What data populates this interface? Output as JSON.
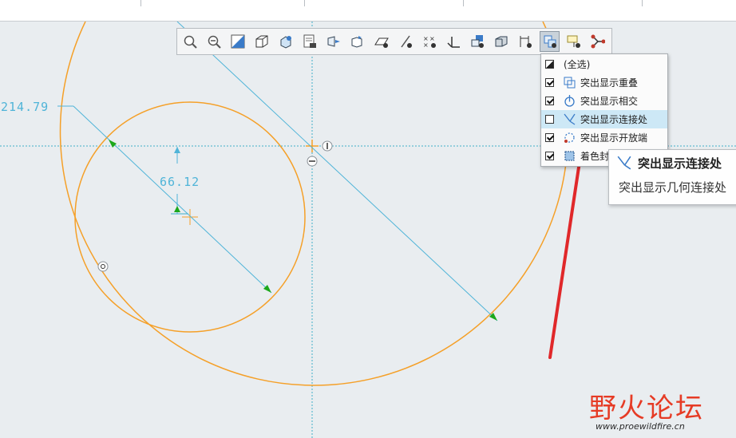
{
  "toolbar": {
    "buttons": [
      {
        "name": "zoom-in-button"
      },
      {
        "name": "zoom-out-button"
      },
      {
        "name": "refit-button"
      },
      {
        "name": "display-style-button"
      },
      {
        "name": "saved-orientations-button"
      },
      {
        "name": "view-manager-button"
      },
      {
        "name": "perspective-view-button"
      },
      {
        "name": "plane-display-button"
      },
      {
        "name": "axis-display-button"
      },
      {
        "name": "sketch-display-button"
      },
      {
        "name": "point-display-button"
      },
      {
        "name": "csys-display-button"
      },
      {
        "name": "annotation-display-button"
      },
      {
        "name": "spin-center-button"
      },
      {
        "name": "dimension-display-button"
      },
      {
        "name": "sketcher-diagnostics-button",
        "active": true
      },
      {
        "name": "constraints-display-button"
      },
      {
        "name": "vertex-display-button"
      }
    ]
  },
  "dimensions": {
    "large_radius": "214.79",
    "small_radius": "66.12"
  },
  "dropdown": {
    "items": [
      {
        "label": "(全选)",
        "state": "partial",
        "icon": "select-all-icon"
      },
      {
        "label": "突出显示重叠",
        "state": "checked",
        "icon": "overlap-icon"
      },
      {
        "label": "突出显示相交",
        "state": "checked",
        "icon": "intersect-icon"
      },
      {
        "label": "突出显示连接处",
        "state": "unchecked",
        "icon": "junction-icon",
        "highlighted": true
      },
      {
        "label": "突出显示开放端",
        "state": "checked",
        "icon": "open-end-icon"
      },
      {
        "label": "着色封闭环",
        "state": "checked",
        "icon": "shade-closed-loop-icon"
      }
    ]
  },
  "tooltip": {
    "title": "突出显示连接处",
    "description": "突出显示几何连接处"
  },
  "watermark": {
    "brand": "野火论坛",
    "url": "www.proewildfire.cn"
  },
  "colors": {
    "geometry": "#f5a028",
    "dimension": "#4fb4d8",
    "arrow": "#e0282a",
    "canvas": "#e9edf0"
  }
}
